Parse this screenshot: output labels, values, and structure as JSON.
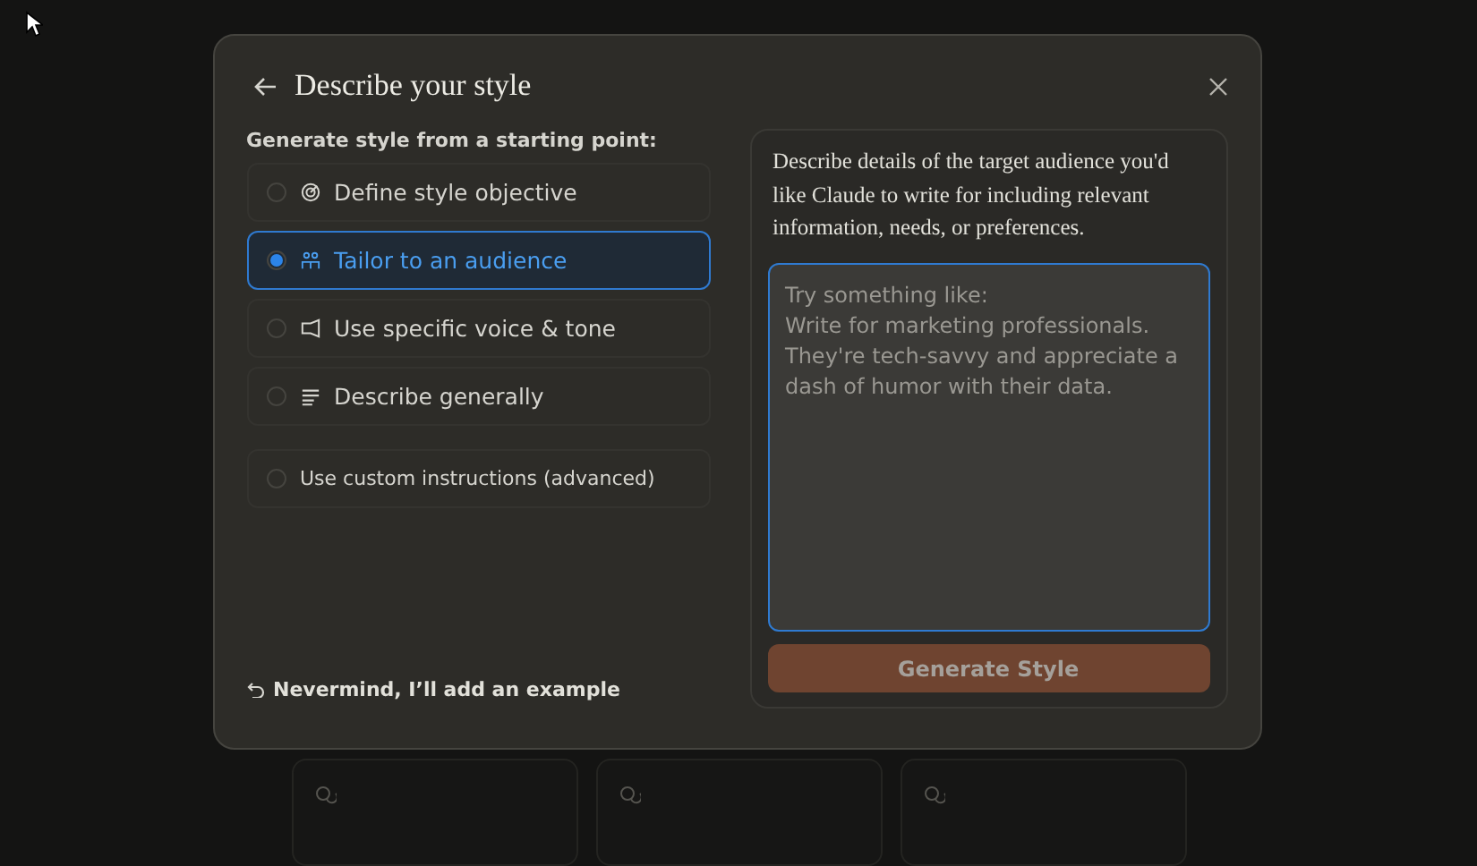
{
  "dialog": {
    "title": "Describe your style",
    "section_label": "Generate style from a starting point:",
    "options": [
      {
        "label": "Define style objective",
        "selected": false
      },
      {
        "label": "Tailor to an audience",
        "selected": true
      },
      {
        "label": "Use specific voice & tone",
        "selected": false
      },
      {
        "label": "Describe generally",
        "selected": false
      },
      {
        "label": "Use custom instructions (advanced)",
        "selected": false
      }
    ],
    "back_link": "Nevermind, I’ll add an example",
    "description": "Describe details of the target audience you'd like Claude to write for including relevant information, needs, or preferences.",
    "input": {
      "placeholder": "Try something like:\nWrite for marketing professionals.\nThey're tech-savvy and appreciate a\ndash of humor with their data."
    },
    "submit": {
      "label": "Generate Style",
      "disabled": true
    }
  }
}
